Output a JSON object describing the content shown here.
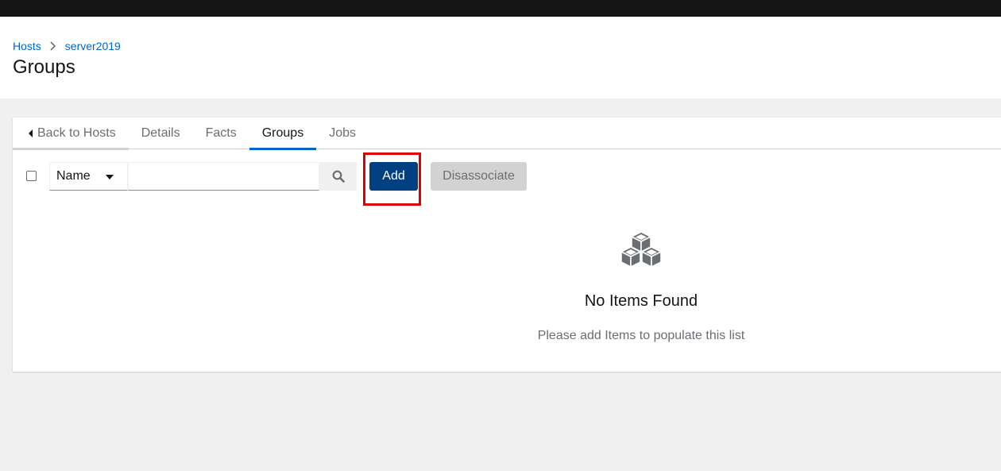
{
  "breadcrumb": [
    {
      "label": "Hosts"
    },
    {
      "label": "server2019"
    }
  ],
  "page": {
    "title": "Groups"
  },
  "tabs": [
    {
      "label": "Back to Hosts"
    },
    {
      "label": "Details"
    },
    {
      "label": "Facts"
    },
    {
      "label": "Groups"
    },
    {
      "label": "Jobs"
    }
  ],
  "active_tab": "Groups",
  "toolbar": {
    "search_field_selected": "Name",
    "search_value": "",
    "search_placeholder": "",
    "add_label": "Add",
    "disassociate_label": "Disassociate"
  },
  "empty_state": {
    "title": "No Items Found",
    "body": "Please add Items to populate this list",
    "icon": "cubes-icon"
  },
  "colors": {
    "accent": "#0066cc",
    "primary_button": "#004080",
    "highlight": "#e00000"
  }
}
